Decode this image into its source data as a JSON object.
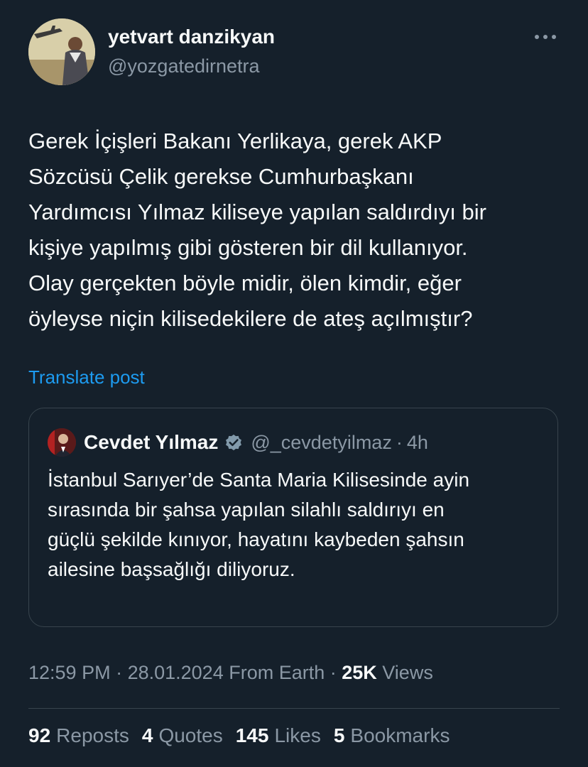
{
  "author": {
    "name": "yetvart danzikyan",
    "handle": "@yozgatedirnetra"
  },
  "tweet": {
    "text": "Gerek İçişleri Bakanı Yerlikaya, gerek AKP\nSözcüsü Çelik gerekse Cumhurbaşkanı\nYardımcısı Yılmaz kiliseye yapılan saldırdıyı bir\nkişiye yapılmış gibi gösteren bir dil kullanıyor.\nOlay gerçekten böyle midir, ölen kimdir, eğer\nöyleyse niçin kilisedekilere de ateş açılmıştır?",
    "translate_label": "Translate post"
  },
  "quote": {
    "name": "Cevdet Yılmaz",
    "handle": "@_cevdetyilmaz",
    "separator": "·",
    "time": "4h",
    "text": "İstanbul Sarıyer’de Santa Maria Kilisesinde ayin\nsırasında bir şahsa yapılan silahlı saldırıyı en\ngüçlü şekilde kınıyor, hayatını kaybeden şahsın\nailesine başsağlığı diliyoruz."
  },
  "meta": {
    "time": "12:59 PM",
    "sep1": " · ",
    "date": "28.01.2024",
    "source": " From Earth",
    "sep2": " · ",
    "views_count": "25K",
    "views_label": " Views"
  },
  "stats": [
    {
      "count": "92",
      "label": "Reposts"
    },
    {
      "count": "4",
      "label": "Quotes"
    },
    {
      "count": "145",
      "label": "Likes"
    },
    {
      "count": "5",
      "label": "Bookmarks"
    }
  ],
  "colors": {
    "background": "#15202b",
    "text": "#f7f9f9",
    "secondary": "#8b98a5",
    "link": "#1d9bf0",
    "border": "#38444d"
  },
  "icons": {
    "more": "more-horizontal-icon",
    "verified": "verified-badge-icon"
  }
}
